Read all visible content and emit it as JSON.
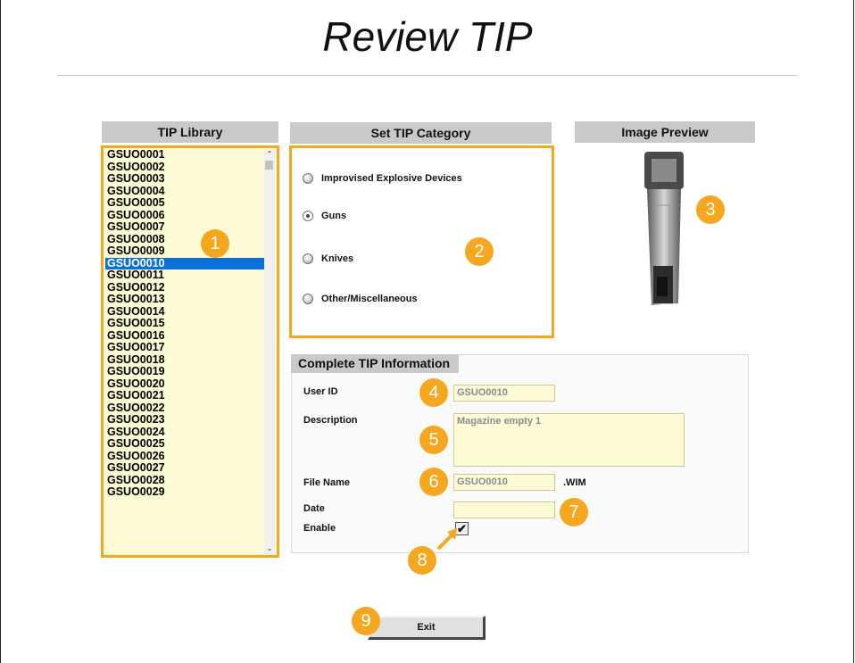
{
  "title": "Review TIP",
  "library": {
    "header": "TIP Library",
    "items": [
      "GSUO0001",
      "GSUO0002",
      "GSUO0003",
      "GSUO0004",
      "GSUO0005",
      "GSUO0006",
      "GSUO0007",
      "GSUO0008",
      "GSUO0009",
      "GSUO0010",
      "GSUO0011",
      "GSUO0012",
      "GSUO0013",
      "GSUO0014",
      "GSUO0015",
      "GSUO0016",
      "GSUO0017",
      "GSUO0018",
      "GSUO0019",
      "GSUO0020",
      "GSUO0021",
      "GSUO0022",
      "GSUO0023",
      "GSUO0024",
      "GSUO0025",
      "GSUO0026",
      "GSUO0027",
      "GSUO0028",
      "GSUO0029"
    ],
    "selected": "GSUO0010"
  },
  "category": {
    "header": "Set TIP Category",
    "options": [
      "Improvised Explosive Devices",
      "Guns",
      "Knives",
      "Other/Miscellaneous"
    ],
    "selected": "Guns"
  },
  "preview": {
    "header": "Image Preview"
  },
  "info": {
    "header": "Complete TIP Information",
    "user_id_label": "User ID",
    "user_id_value": "GSUO0010",
    "description_label": "Description",
    "description_value": "Magazine empty 1",
    "file_name_label": "File Name",
    "file_name_value": "GSUO0010",
    "file_ext": ".WIM",
    "date_label": "Date",
    "date_value": "",
    "enable_label": "Enable",
    "enable_checked": true
  },
  "exit_label": "Exit",
  "badges": [
    "1",
    "2",
    "3",
    "4",
    "5",
    "6",
    "7",
    "8",
    "9"
  ],
  "colors": {
    "highlight": "#f5a81f",
    "field_bg": "#fdfbd6",
    "selection": "#0a6fd6"
  }
}
